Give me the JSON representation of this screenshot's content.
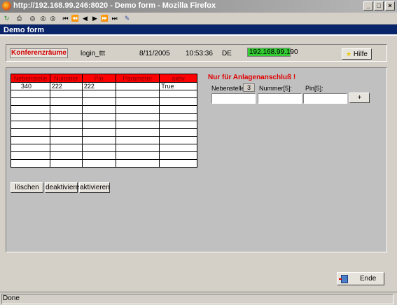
{
  "window": {
    "title": "http://192.168.99.246:8020 - Demo form - Mozilla Firefox",
    "controls": [
      "_",
      "□",
      "×"
    ]
  },
  "toolbar": {
    "icons": [
      "reload-icon",
      "print-icon",
      "search-icon",
      "search-all-icon",
      "search-up-icon",
      "first-icon",
      "previous-page-icon",
      "previous-icon",
      "next-icon",
      "next-page-icon",
      "last-icon",
      "edit-icon"
    ]
  },
  "form": {
    "title": "Demo form"
  },
  "info": {
    "konferenzraume": "Konferenzräume",
    "login": "login_ttt",
    "date": "8/11/2005",
    "time": "10:53:36",
    "lang": "DE",
    "ip": "192.168.99.190",
    "hilfe": "Hilfe"
  },
  "table": {
    "columns": [
      "Nebenstelle",
      "Nummer",
      "Pin",
      "Parameter",
      "aktiv"
    ],
    "rows": [
      [
        "340",
        "222",
        "222",
        "",
        "True"
      ],
      [
        "",
        "",
        "",
        "",
        ""
      ],
      [
        "",
        "",
        "",
        "",
        ""
      ],
      [
        "",
        "",
        "",
        "",
        ""
      ],
      [
        "",
        "",
        "",
        "",
        ""
      ],
      [
        "",
        "",
        "",
        "",
        ""
      ],
      [
        "",
        "",
        "",
        "",
        ""
      ],
      [
        "",
        "",
        "",
        "",
        ""
      ],
      [
        "",
        "",
        "",
        "",
        ""
      ],
      [
        "",
        "",
        "",
        "",
        ""
      ],
      [
        "",
        "",
        "",
        "",
        ""
      ]
    ]
  },
  "actions": {
    "loschen": "löschen",
    "deaktivieren": "deaktivieren",
    "aktivieren": "aktivieren"
  },
  "entry": {
    "hint": "Nur für Anlagenanschluß !",
    "nebenstelle_label": "Nebenstelle",
    "nebenstelle_value": "3",
    "nummer_label": "Nummer[5]:",
    "pin_label": "Pin[5]:",
    "add_label": "+"
  },
  "footer": {
    "ende": "Ende"
  },
  "status": {
    "text": "Done"
  },
  "colors": {
    "header_bg": "#0a246a",
    "table_header_bg": "#ff0000",
    "ip_bg": "#33cc33",
    "hint_color": "#e00000"
  }
}
